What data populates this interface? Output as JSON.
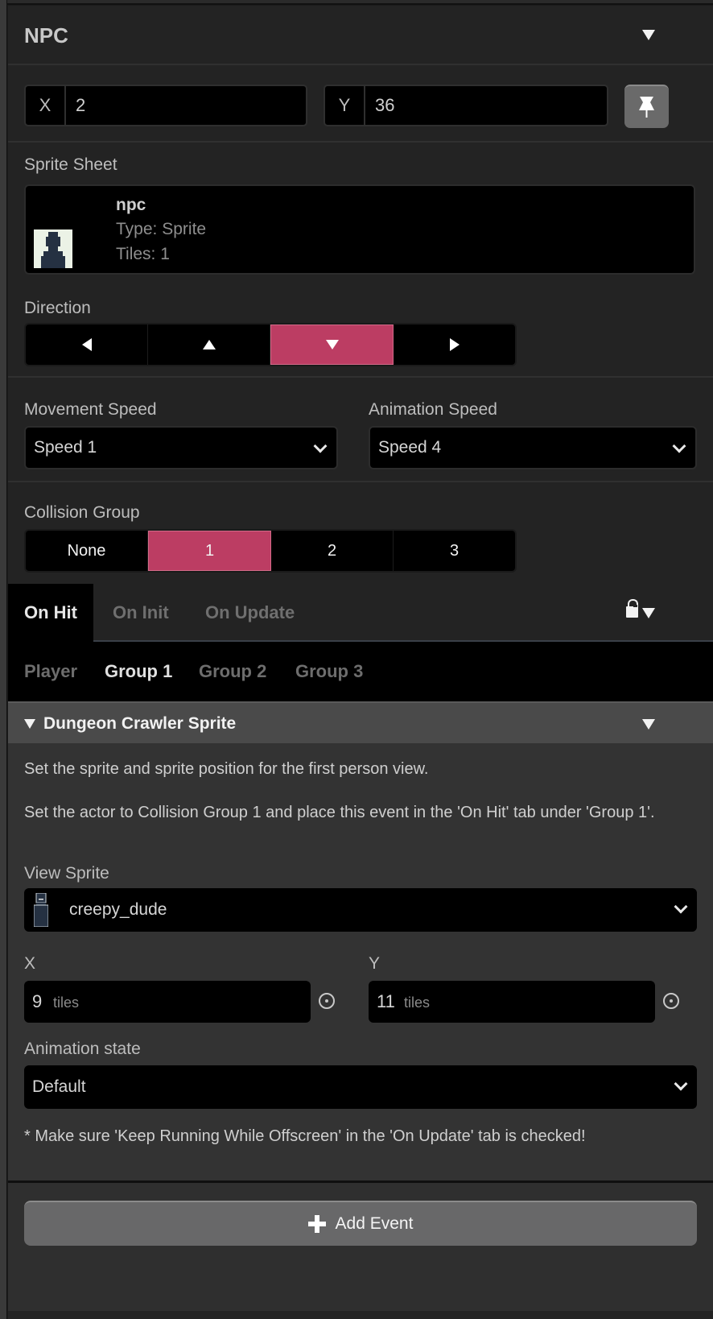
{
  "header": {
    "title": "NPC"
  },
  "position": {
    "x_label": "X",
    "x_value": "2",
    "y_label": "Y",
    "y_value": "36"
  },
  "sprite_sheet": {
    "label": "Sprite Sheet",
    "name": "npc",
    "type_label": "Type:",
    "type_value": "Sprite",
    "tiles_label": "Tiles:",
    "tiles_value": "1"
  },
  "direction": {
    "label": "Direction",
    "options": [
      "left",
      "up",
      "down",
      "right"
    ],
    "selected": "down"
  },
  "movement_speed": {
    "label": "Movement Speed",
    "value": "Speed 1"
  },
  "animation_speed": {
    "label": "Animation Speed",
    "value": "Speed 4"
  },
  "collision_group": {
    "label": "Collision Group",
    "options": [
      "None",
      "1",
      "2",
      "3"
    ],
    "selected": "1"
  },
  "script_tabs": {
    "tabs": [
      "On Hit",
      "On Init",
      "On Update"
    ],
    "active": "On Hit"
  },
  "hit_groups": {
    "tabs": [
      "Player",
      "Group 1",
      "Group 2",
      "Group 3"
    ],
    "active": "Group 1"
  },
  "event": {
    "title": "Dungeon Crawler Sprite",
    "description_1": "Set the sprite and sprite position for the first person view.",
    "description_2": "Set the actor to Collision Group 1 and place this event in the 'On Hit' tab under 'Group 1'.",
    "view_sprite_label": "View Sprite",
    "view_sprite_value": "creepy_dude",
    "x_label": "X",
    "x_value": "9",
    "x_unit": "tiles",
    "y_label": "Y",
    "y_value": "11",
    "y_unit": "tiles",
    "animation_state_label": "Animation state",
    "animation_state_value": "Default",
    "note": "* Make sure 'Keep Running While Offscreen' in the 'On Update' tab is checked!"
  },
  "footer": {
    "add_event_label": "Add Event"
  },
  "colors": {
    "accent": "#bc3d63",
    "panel": "#232323",
    "event_body": "#333333"
  }
}
